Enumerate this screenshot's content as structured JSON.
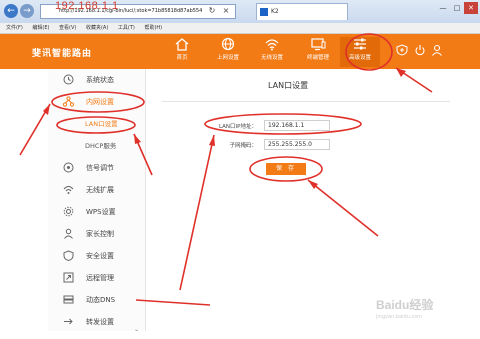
{
  "overlay_ip": "192.168.1.1",
  "browser": {
    "url": "http://192.168.1.1/cgi-bin/luci/;stok=71b85818d87ab554",
    "tab_title": "K2",
    "menu": [
      "文件(F)",
      "编辑(E)",
      "查看(V)",
      "收藏夹(A)",
      "工具(T)",
      "帮助(H)"
    ],
    "controls": [
      "—",
      "□",
      "✕"
    ]
  },
  "header": {
    "brand": "斐讯智能路由",
    "nav": [
      {
        "label": "首页",
        "icon": "home-icon"
      },
      {
        "label": "上网设置",
        "icon": "globe-icon"
      },
      {
        "label": "无线设置",
        "icon": "wifi-icon"
      },
      {
        "label": "终端管理",
        "icon": "monitor-icon"
      },
      {
        "label": "高级设置",
        "icon": "sliders-icon",
        "active": true
      }
    ]
  },
  "sidebar": {
    "items": [
      {
        "label": "系统状态",
        "icon": "clock-icon"
      },
      {
        "label": "内网设置",
        "icon": "network-icon",
        "active": true
      },
      {
        "label": "LAN口设置",
        "sub": true,
        "current": true
      },
      {
        "label": "DHCP服务",
        "sub": true
      },
      {
        "label": "信号调节",
        "icon": "signal-icon"
      },
      {
        "label": "无线扩展",
        "icon": "extend-icon"
      },
      {
        "label": "WPS设置",
        "icon": "gear-icon"
      },
      {
        "label": "家长控制",
        "icon": "user-icon"
      },
      {
        "label": "安全设置",
        "icon": "shield-icon"
      },
      {
        "label": "远程管理",
        "icon": "remote-icon"
      },
      {
        "label": "动态DNS",
        "icon": "dns-icon"
      },
      {
        "label": "转发设置",
        "icon": "forward-icon"
      }
    ]
  },
  "main": {
    "title": "LAN口设置",
    "lan_ip_label": "LAN口IP地址：",
    "lan_ip_value": "192.168.1.1",
    "mask_label": "子网掩码：",
    "mask_value": "255.255.255.0",
    "save_label": "保 存"
  },
  "watermark": {
    "text": "Baidu经验",
    "sub": "jingyan.baidu.com"
  },
  "colors": {
    "accent": "#f27b16",
    "annotation": "#e0302a"
  }
}
